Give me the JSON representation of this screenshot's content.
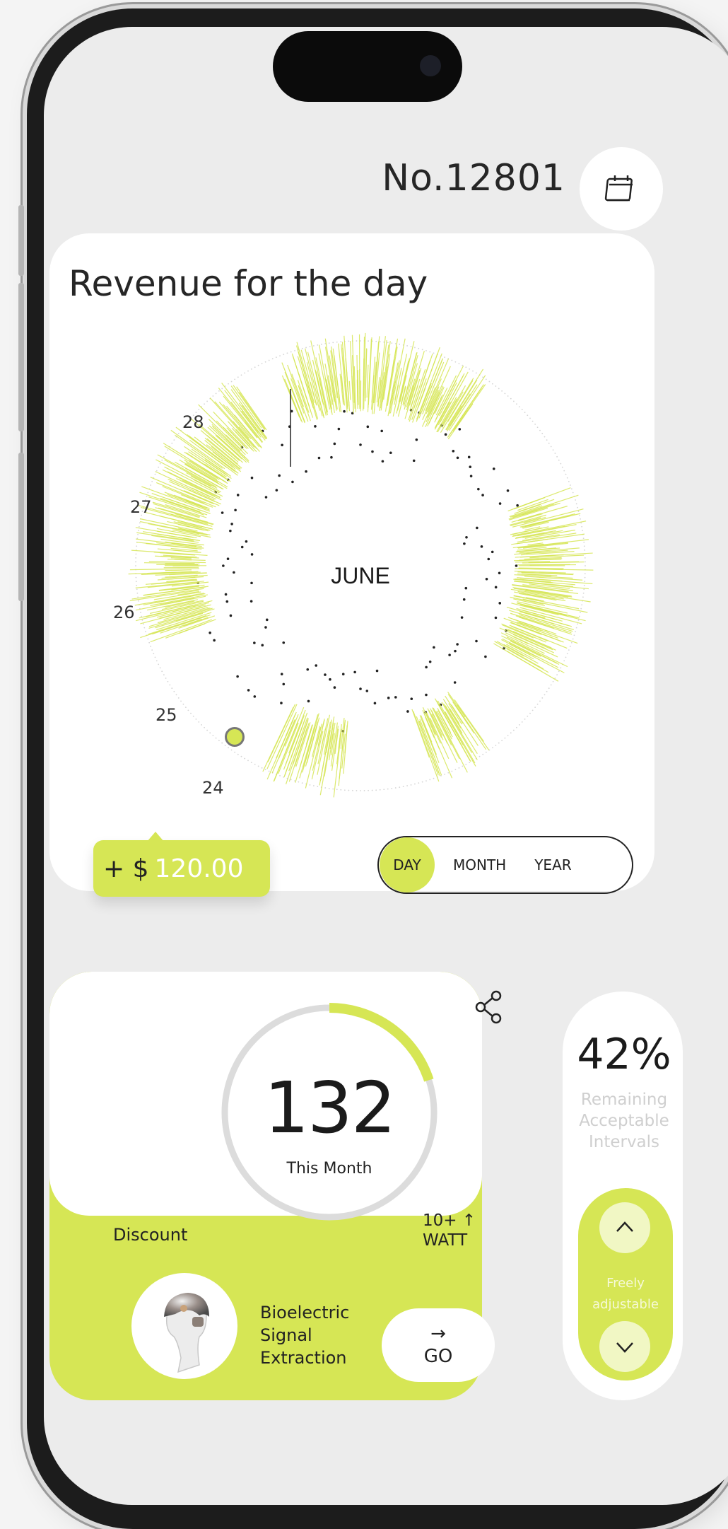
{
  "colors": {
    "accent": "#d6e655",
    "accent_light": "#f1f7c4",
    "background": "#ececec",
    "card": "#ffffff",
    "text": "#222222",
    "muted": "#cfcfcf"
  },
  "header": {
    "order_number": "No.12801",
    "calendar_icon": "calendar-icon"
  },
  "revenue": {
    "title": "Revenue for the day",
    "center_label": "JUNE",
    "day_labels": [
      "28",
      "27",
      "26",
      "25",
      "24"
    ],
    "amount_sign": "+ $",
    "amount_value": "120.00",
    "periods": [
      "DAY",
      "MONTH",
      "YEAR"
    ],
    "selected_period": "DAY"
  },
  "stats": {
    "count": "132",
    "count_label": "This Month",
    "progress": 0.2,
    "discount_label": "Discount",
    "watt_value": "10+ ↑",
    "watt_unit": "WATT",
    "share_icon": "share-icon",
    "product_line1": "Bioelectric",
    "product_line2": "Signal",
    "product_line3": "Extraction",
    "go_arrow": "→",
    "go_label": "GO"
  },
  "intervals": {
    "percent": "42%",
    "line1": "Remaining",
    "line2": "Acceptable",
    "line3": "Intervals",
    "adjust_line1": "Freely",
    "adjust_line2": "adjustable",
    "up_icon": "chevron-up-icon",
    "down_icon": "chevron-down-icon"
  }
}
